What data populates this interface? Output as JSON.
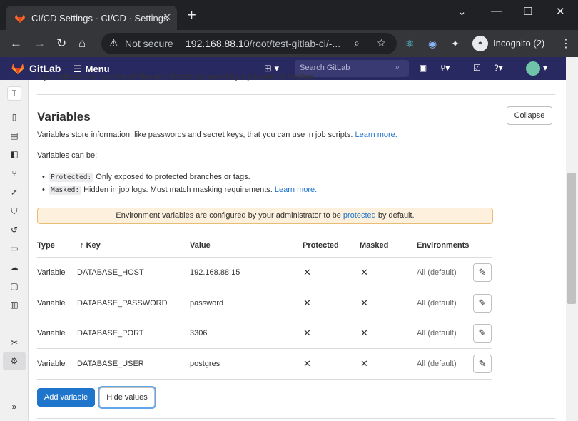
{
  "browser": {
    "tab_title": "CI/CD Settings · CI/CD · Settings",
    "tab_close": "✕",
    "new_tab": "+",
    "security_label": "Not secure",
    "url_host": "192.168.88.10",
    "url_path": "/root/test-gitlab-ci/-...",
    "incognito_label": "Incognito (2)"
  },
  "gitlab": {
    "brand": "GitLab",
    "menu_label": "Menu",
    "search_placeholder": "Search GitLab",
    "project_initial": "T"
  },
  "content": {
    "truncated_line": "A job artifact is an archive of files and directories saved by a job when it finishes.",
    "section_title": "Variables",
    "collapse_label": "Collapse",
    "description": "Variables store information, like passwords and secret keys, that you can use in job scripts.",
    "description_link": "Learn more.",
    "can_be": "Variables can be:",
    "bullets": [
      {
        "code": "Protected:",
        "text": "Only exposed to protected branches or tags.",
        "link": ""
      },
      {
        "code": "Masked:",
        "text": "Hidden in job logs. Must match masking requirements.",
        "link": "Learn more."
      }
    ],
    "alert_prefix": "Environment variables are configured by your administrator to be",
    "alert_link": "protected",
    "alert_suffix": "by default."
  },
  "table": {
    "headers": {
      "type": "Type",
      "key_arrow": "↑",
      "key": "Key",
      "value": "Value",
      "protected": "Protected",
      "masked": "Masked",
      "environments": "Environments"
    },
    "rows": [
      {
        "type": "Variable",
        "key": "DATABASE_HOST",
        "value": "192.168.88.15",
        "protected": "✕",
        "masked": "✕",
        "environment": "All (default)"
      },
      {
        "type": "Variable",
        "key": "DATABASE_PASSWORD",
        "value": "password",
        "protected": "✕",
        "masked": "✕",
        "environment": "All (default)"
      },
      {
        "type": "Variable",
        "key": "DATABASE_PORT",
        "value": "3306",
        "protected": "✕",
        "masked": "✕",
        "environment": "All (default)"
      },
      {
        "type": "Variable",
        "key": "DATABASE_USER",
        "value": "postgres",
        "protected": "✕",
        "masked": "✕",
        "environment": "All (default)"
      }
    ]
  },
  "actions": {
    "add_variable": "Add variable",
    "hide_values": "Hide values"
  },
  "colors": {
    "header_bg": "#292961",
    "primary": "#1f75cb",
    "alert_bg": "#fdf1dd",
    "alert_border": "#e9be74"
  },
  "icons": {
    "sidebar": [
      "project-info-icon",
      "repository-icon",
      "issues-icon",
      "merge-requests-icon",
      "cicd-icon",
      "security-icon",
      "deployments-icon",
      "monitor-icon",
      "infrastructure-icon",
      "packages-icon",
      "analytics-icon",
      "snippets-icon",
      "settings-icon",
      "collapse-sidebar-icon"
    ]
  }
}
